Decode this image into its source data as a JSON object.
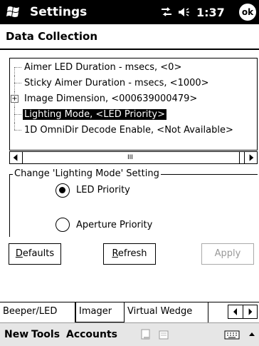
{
  "titlebar": {
    "app_name": "Settings",
    "time": "1:37",
    "ok_label": "ok"
  },
  "page": {
    "title": "Data Collection"
  },
  "tree": {
    "items": [
      {
        "label": "Aimer LED Duration - msecs, <0>",
        "expandable": false,
        "selected": false
      },
      {
        "label": "Sticky Aimer Duration - msecs, <1000>",
        "expandable": false,
        "selected": false
      },
      {
        "label": "Image Dimension, <000639000479>",
        "expandable": true,
        "selected": false
      },
      {
        "label": "Lighting Mode, <LED Priority>",
        "expandable": false,
        "selected": true
      },
      {
        "label": "1D OmniDir Decode Enable, <Not Available>",
        "expandable": false,
        "selected": false
      }
    ]
  },
  "scroll": {
    "grip": "III"
  },
  "setting_group": {
    "legend": "Change 'Lighting Mode' Setting",
    "options": [
      {
        "label": "LED Priority",
        "checked": true
      },
      {
        "label": "Aperture Priority",
        "checked": false
      }
    ]
  },
  "buttons": {
    "defaults": {
      "mnemonic": "D",
      "rest": "efaults"
    },
    "refresh": {
      "mnemonic": "R",
      "rest": "efresh"
    },
    "apply": {
      "label": "Apply"
    }
  },
  "tabs": [
    {
      "label": "Beeper/LED",
      "active": false
    },
    {
      "label": "Imager",
      "active": true
    },
    {
      "label": "Virtual Wedge",
      "active": false
    }
  ],
  "menubar": {
    "items": [
      "New",
      "Tools",
      "Accounts"
    ]
  },
  "icons": {
    "start": "windows-flag-icon",
    "connectivity": "connectivity-icon",
    "volume": "speaker-icon",
    "keyboard": "keyboard-icon"
  }
}
